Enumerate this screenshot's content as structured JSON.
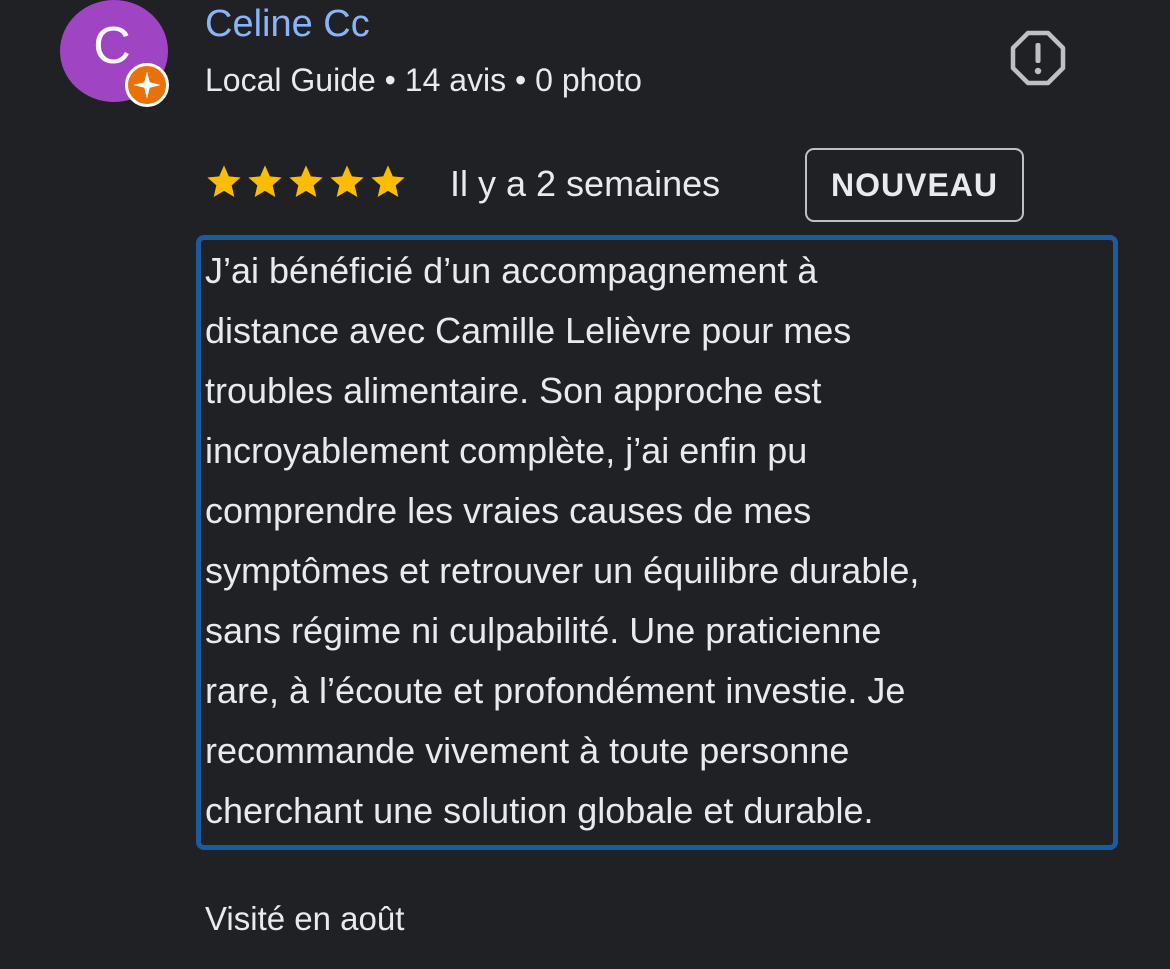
{
  "review": {
    "avatar": {
      "initial": "C",
      "color": "#9f45c4",
      "badge_icon": "local-guide-star-icon",
      "badge_color": "#e8710a"
    },
    "reviewer_name": "Celine Cc",
    "reviewer_meta": "Local Guide • 14 avis • 0 photo",
    "report_icon": "report-icon",
    "rating": 5,
    "rating_max": 5,
    "star_color": "#fbbc04",
    "date": "Il y a 2 semaines",
    "new_badge": "NOUVEAU",
    "text_lines": [
      "J’ai bénéficié d’un accompagnement à",
      "distance avec Camille Lelièvre pour mes",
      "troubles alimentaire. Son approche est",
      "incroyablement complète, j’ai enfin pu",
      "comprendre les vraies causes de mes",
      "symptômes et retrouver un équilibre durable,",
      "sans régime ni culpabilité. Une praticienne",
      "rare, à l’écoute et profondément investie. Je",
      "recommande vivement à toute personne",
      "cherchant une solution globale et durable."
    ],
    "highlight_color": "#1e5a9e",
    "visited": "Visité en août"
  }
}
